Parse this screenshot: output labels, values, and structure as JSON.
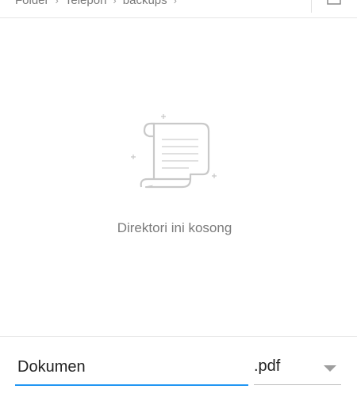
{
  "breadcrumb": {
    "items": [
      "Folder",
      "Telepon",
      "backups"
    ],
    "separator": "›"
  },
  "empty_state": {
    "message": "Direktori ini kosong",
    "illustration": "scroll-icon"
  },
  "toolbar": {
    "new_folder_icon": "new-folder-icon"
  },
  "save_bar": {
    "filename_value": "Dokumen",
    "extension": ".pdf",
    "dropdown_icon": "chevron-down-icon"
  },
  "colors": {
    "accent": "#2196f3",
    "muted_text": "#7b7b7b",
    "divider": "#e6e6e6"
  }
}
